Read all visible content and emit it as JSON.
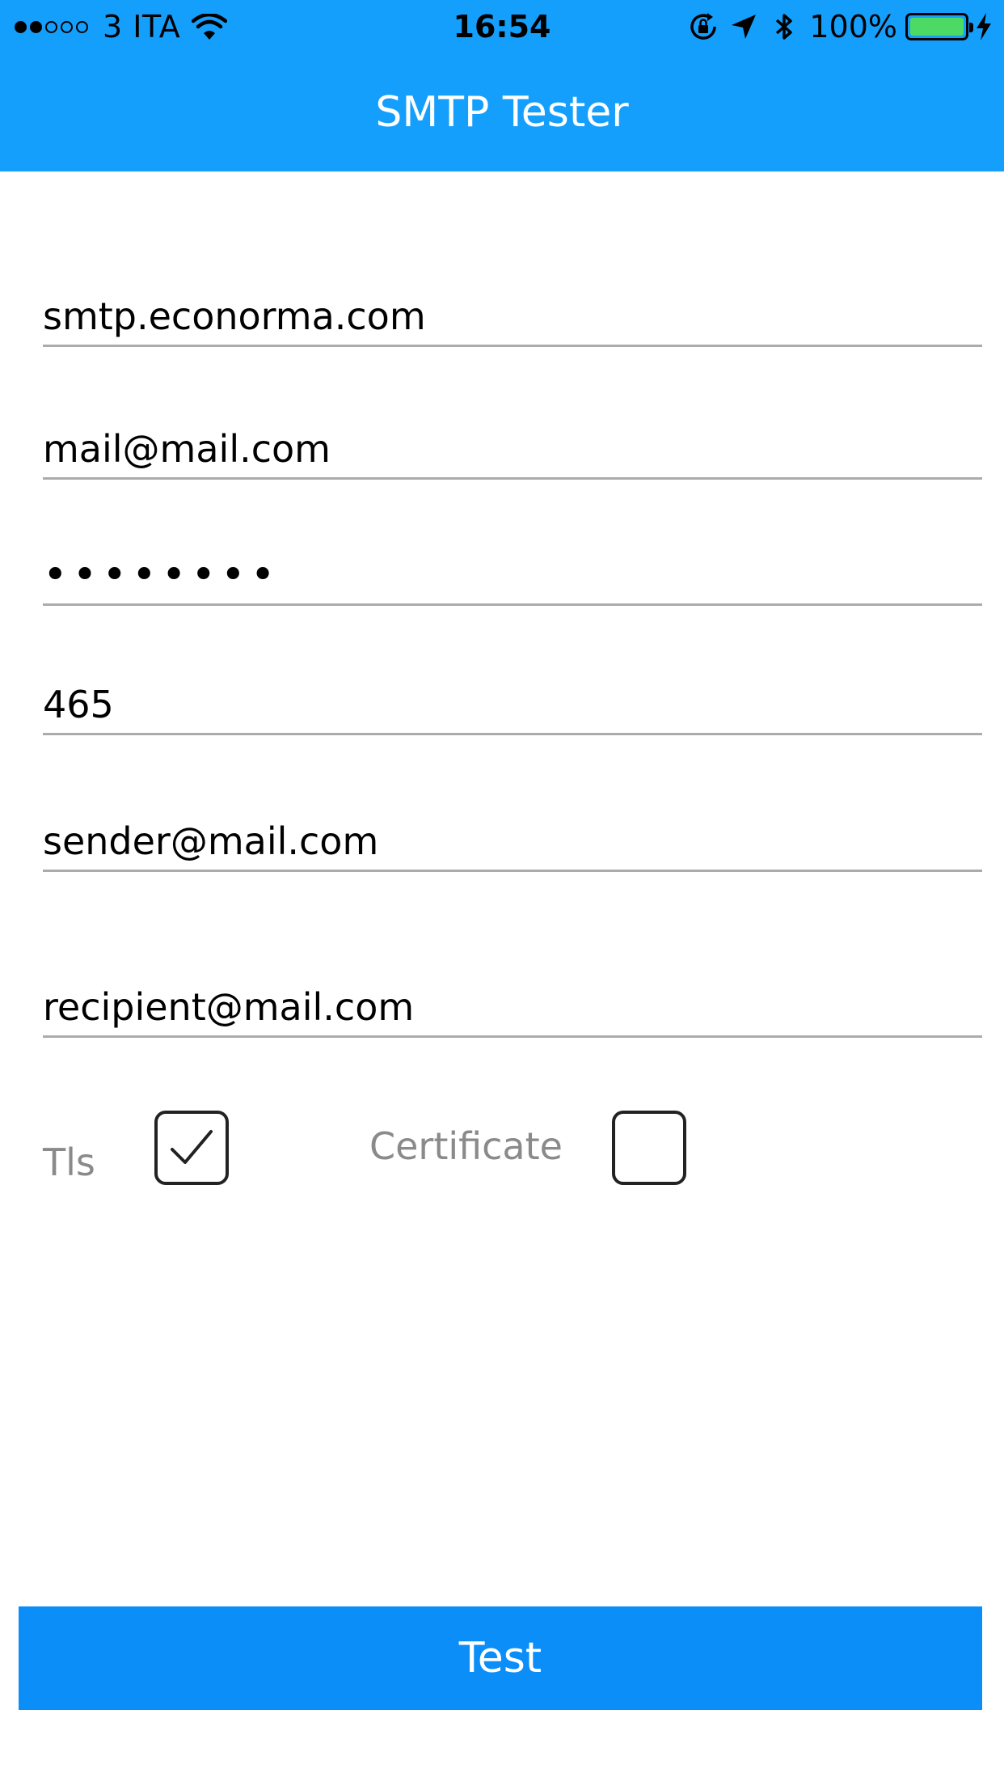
{
  "status_bar": {
    "carrier": "3 ITA",
    "time": "16:54",
    "battery_percent": "100%",
    "battery_level": 1.0,
    "icons": [
      "signal-dots-icon",
      "wifi-icon",
      "rotation-lock-icon",
      "location-arrow-icon",
      "bluetooth-icon",
      "battery-icon",
      "charging-bolt-icon"
    ]
  },
  "nav": {
    "title": "SMTP Tester"
  },
  "form": {
    "host": "smtp.econorma.com",
    "username": "mail@mail.com",
    "password": "password",
    "port": "465",
    "sender": "sender@mail.com",
    "recipient": "recipient@mail.com",
    "tls_label": "Tls",
    "tls_checked": true,
    "certificate_label": "Certificate",
    "certificate_checked": false
  },
  "actions": {
    "test_label": "Test"
  },
  "colors": {
    "header": "#159ffd",
    "button": "#0b8ef8",
    "battery": "#4cd964",
    "underline": "#ababab",
    "label": "#8a8a8a"
  }
}
